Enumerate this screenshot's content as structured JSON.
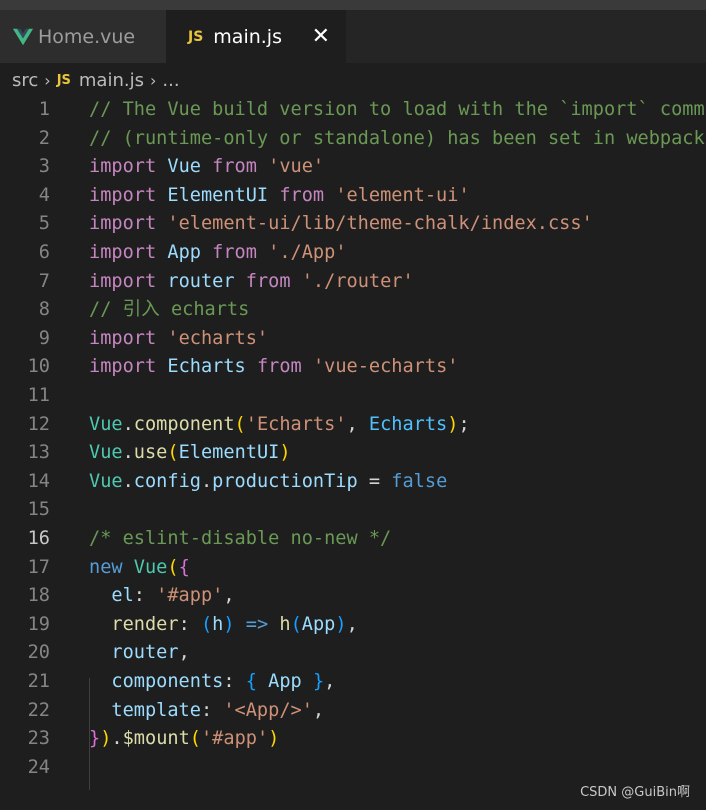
{
  "tabs": [
    {
      "label": "Home.vue",
      "icon": "vue-icon",
      "active": false
    },
    {
      "label": "main.js",
      "icon": "js-icon",
      "active": true
    }
  ],
  "tab_badge": "JS",
  "tab_close_glyph": "✕",
  "breadcrumb": {
    "folder": "src",
    "file_badge": "JS",
    "file": "main.js",
    "ellipsis": "..."
  },
  "current_line": 16,
  "lines": [
    {
      "n": "1",
      "tokens": [
        [
          "// The Vue build version to load with the `import` command",
          "comment"
        ]
      ]
    },
    {
      "n": "2",
      "tokens": [
        [
          "// (runtime-only or standalone) has been set in webpack.base.conf with an alias.",
          "comment"
        ]
      ]
    },
    {
      "n": "3",
      "tokens": [
        [
          "import",
          "keyword"
        ],
        [
          " ",
          "punc"
        ],
        [
          "Vue",
          "var"
        ],
        [
          " ",
          "punc"
        ],
        [
          "from",
          "keyword"
        ],
        [
          " ",
          "punc"
        ],
        [
          "'vue'",
          "str"
        ]
      ]
    },
    {
      "n": "4",
      "tokens": [
        [
          "import",
          "keyword"
        ],
        [
          " ",
          "punc"
        ],
        [
          "ElementUI",
          "var"
        ],
        [
          " ",
          "punc"
        ],
        [
          "from",
          "keyword"
        ],
        [
          " ",
          "punc"
        ],
        [
          "'element-ui'",
          "str"
        ]
      ]
    },
    {
      "n": "5",
      "tokens": [
        [
          "import",
          "keyword"
        ],
        [
          " ",
          "punc"
        ],
        [
          "'element-ui/lib/theme-chalk/index.css'",
          "str"
        ]
      ]
    },
    {
      "n": "6",
      "tokens": [
        [
          "import",
          "keyword"
        ],
        [
          " ",
          "punc"
        ],
        [
          "App",
          "var"
        ],
        [
          " ",
          "punc"
        ],
        [
          "from",
          "keyword"
        ],
        [
          " ",
          "punc"
        ],
        [
          "'./App'",
          "str"
        ]
      ]
    },
    {
      "n": "7",
      "tokens": [
        [
          "import",
          "keyword"
        ],
        [
          " ",
          "punc"
        ],
        [
          "router",
          "var"
        ],
        [
          " ",
          "punc"
        ],
        [
          "from",
          "keyword"
        ],
        [
          " ",
          "punc"
        ],
        [
          "'./router'",
          "str"
        ]
      ]
    },
    {
      "n": "8",
      "tokens": [
        [
          "// 引入 echarts",
          "comment"
        ]
      ]
    },
    {
      "n": "9",
      "tokens": [
        [
          "import",
          "keyword"
        ],
        [
          " ",
          "punc"
        ],
        [
          "'echarts'",
          "str"
        ]
      ]
    },
    {
      "n": "10",
      "tokens": [
        [
          "import",
          "keyword"
        ],
        [
          " ",
          "punc"
        ],
        [
          "Echarts",
          "var"
        ],
        [
          " ",
          "punc"
        ],
        [
          "from",
          "keyword"
        ],
        [
          " ",
          "punc"
        ],
        [
          "'vue-echarts'",
          "str"
        ]
      ]
    },
    {
      "n": "11",
      "tokens": []
    },
    {
      "n": "12",
      "tokens": [
        [
          "Vue",
          "cls"
        ],
        [
          ".",
          "punc"
        ],
        [
          "component",
          "fn"
        ],
        [
          "(",
          "brace1"
        ],
        [
          "'Echarts'",
          "str"
        ],
        [
          ", ",
          "punc"
        ],
        [
          "Echarts",
          "const"
        ],
        [
          ")",
          "brace1"
        ],
        [
          ";",
          "punc"
        ]
      ]
    },
    {
      "n": "13",
      "tokens": [
        [
          "Vue",
          "cls"
        ],
        [
          ".",
          "punc"
        ],
        [
          "use",
          "fn"
        ],
        [
          "(",
          "brace1"
        ],
        [
          "ElementUI",
          "var"
        ],
        [
          ")",
          "brace1"
        ]
      ]
    },
    {
      "n": "14",
      "tokens": [
        [
          "Vue",
          "cls"
        ],
        [
          ".",
          "punc"
        ],
        [
          "config",
          "var"
        ],
        [
          ".",
          "punc"
        ],
        [
          "productionTip",
          "var"
        ],
        [
          " = ",
          "punc"
        ],
        [
          "false",
          "storage"
        ]
      ]
    },
    {
      "n": "15",
      "tokens": []
    },
    {
      "n": "16",
      "tokens": [
        [
          "/* eslint-disable no-new */",
          "comment"
        ]
      ]
    },
    {
      "n": "17",
      "tokens": [
        [
          "new",
          "storage"
        ],
        [
          " ",
          "punc"
        ],
        [
          "Vue",
          "cls"
        ],
        [
          "(",
          "brace1"
        ],
        [
          "{",
          "brace2"
        ]
      ]
    },
    {
      "n": "18",
      "tokens": [
        [
          "  ",
          "punc"
        ],
        [
          "el",
          "var"
        ],
        [
          ": ",
          "punc"
        ],
        [
          "'#app'",
          "str"
        ],
        [
          ",",
          "punc"
        ]
      ]
    },
    {
      "n": "19",
      "tokens": [
        [
          "  ",
          "punc"
        ],
        [
          "render",
          "fn"
        ],
        [
          ": ",
          "punc"
        ],
        [
          "(",
          "brace3"
        ],
        [
          "h",
          "var"
        ],
        [
          ")",
          "brace3"
        ],
        [
          " ",
          "punc"
        ],
        [
          "=>",
          "storage"
        ],
        [
          " ",
          "punc"
        ],
        [
          "h",
          "fn"
        ],
        [
          "(",
          "brace3"
        ],
        [
          "App",
          "var"
        ],
        [
          ")",
          "brace3"
        ],
        [
          ",",
          "punc"
        ]
      ]
    },
    {
      "n": "20",
      "tokens": [
        [
          "  ",
          "punc"
        ],
        [
          "router",
          "var"
        ],
        [
          ",",
          "punc"
        ]
      ]
    },
    {
      "n": "21",
      "tokens": [
        [
          "  ",
          "punc"
        ],
        [
          "components",
          "var"
        ],
        [
          ": ",
          "punc"
        ],
        [
          "{",
          "brace3"
        ],
        [
          " ",
          "punc"
        ],
        [
          "App",
          "var"
        ],
        [
          " ",
          "punc"
        ],
        [
          "}",
          "brace3"
        ],
        [
          ",",
          "punc"
        ]
      ]
    },
    {
      "n": "22",
      "tokens": [
        [
          "  ",
          "punc"
        ],
        [
          "template",
          "var"
        ],
        [
          ": ",
          "punc"
        ],
        [
          "'<App/>'",
          "str"
        ],
        [
          ",",
          "punc"
        ]
      ]
    },
    {
      "n": "23",
      "tokens": [
        [
          "}",
          "brace2"
        ],
        [
          ")",
          "brace1"
        ],
        [
          ".",
          "punc"
        ],
        [
          "$mount",
          "fn"
        ],
        [
          "(",
          "brace1"
        ],
        [
          "'#app'",
          "str"
        ],
        [
          ")",
          "brace1"
        ]
      ]
    },
    {
      "n": "24",
      "tokens": []
    }
  ],
  "watermark": "CSDN @GuiBin啊",
  "colors": {
    "editor_bg": "#1e1e1e",
    "tab_inactive_bg": "#2d2d2d",
    "comment": "#6a9955",
    "keyword": "#c586c0",
    "string": "#ce9178",
    "variable": "#9cdcfe",
    "class": "#4ec9b0",
    "function": "#dcdcaa"
  }
}
